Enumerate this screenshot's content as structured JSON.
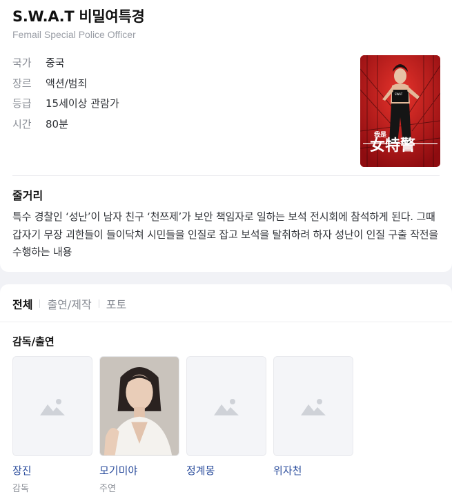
{
  "movie": {
    "title": "S.W.A.T 비밀여특경",
    "subtitle": "Femail Special Police Officer"
  },
  "info": [
    {
      "key": "국가",
      "value": "중국"
    },
    {
      "key": "장르",
      "value": "액션/범죄"
    },
    {
      "key": "등급",
      "value": "15세이상 관람가"
    },
    {
      "key": "시간",
      "value": "80분"
    }
  ],
  "poster": {
    "small_text": "我是",
    "big_text": "女特警",
    "badge": "SWAT"
  },
  "plot": {
    "heading": "줄거리",
    "text": "특수 경찰인 ‘성난’이 남자 친구 ‘천쯔제’가 보안 책임자로 일하는 보석 전시회에 참석하게 된다. 그때 갑자기 무장 괴한들이 들이닥쳐 시민들을 인질로 잡고 보석을 탈취하려 하자 성난이 인질 구출 작전을 수행하는 내용"
  },
  "tabs": [
    {
      "label": "전체"
    },
    {
      "label": "출연/제작"
    },
    {
      "label": "포토"
    }
  ],
  "cast_section": {
    "heading": "감독/출연",
    "people": [
      {
        "name": "장진",
        "role": "감독",
        "photo": "placeholder-image-icon"
      },
      {
        "name": "모기미야",
        "role": "주연",
        "photo": "portrait"
      },
      {
        "name": "정계몽",
        "role": "",
        "photo": "placeholder-image-icon"
      },
      {
        "name": "위자천",
        "role": "",
        "photo": "placeholder-image-icon"
      }
    ]
  },
  "colors": {
    "link": "#2a4c9c",
    "poster_red": "#c8161b"
  }
}
